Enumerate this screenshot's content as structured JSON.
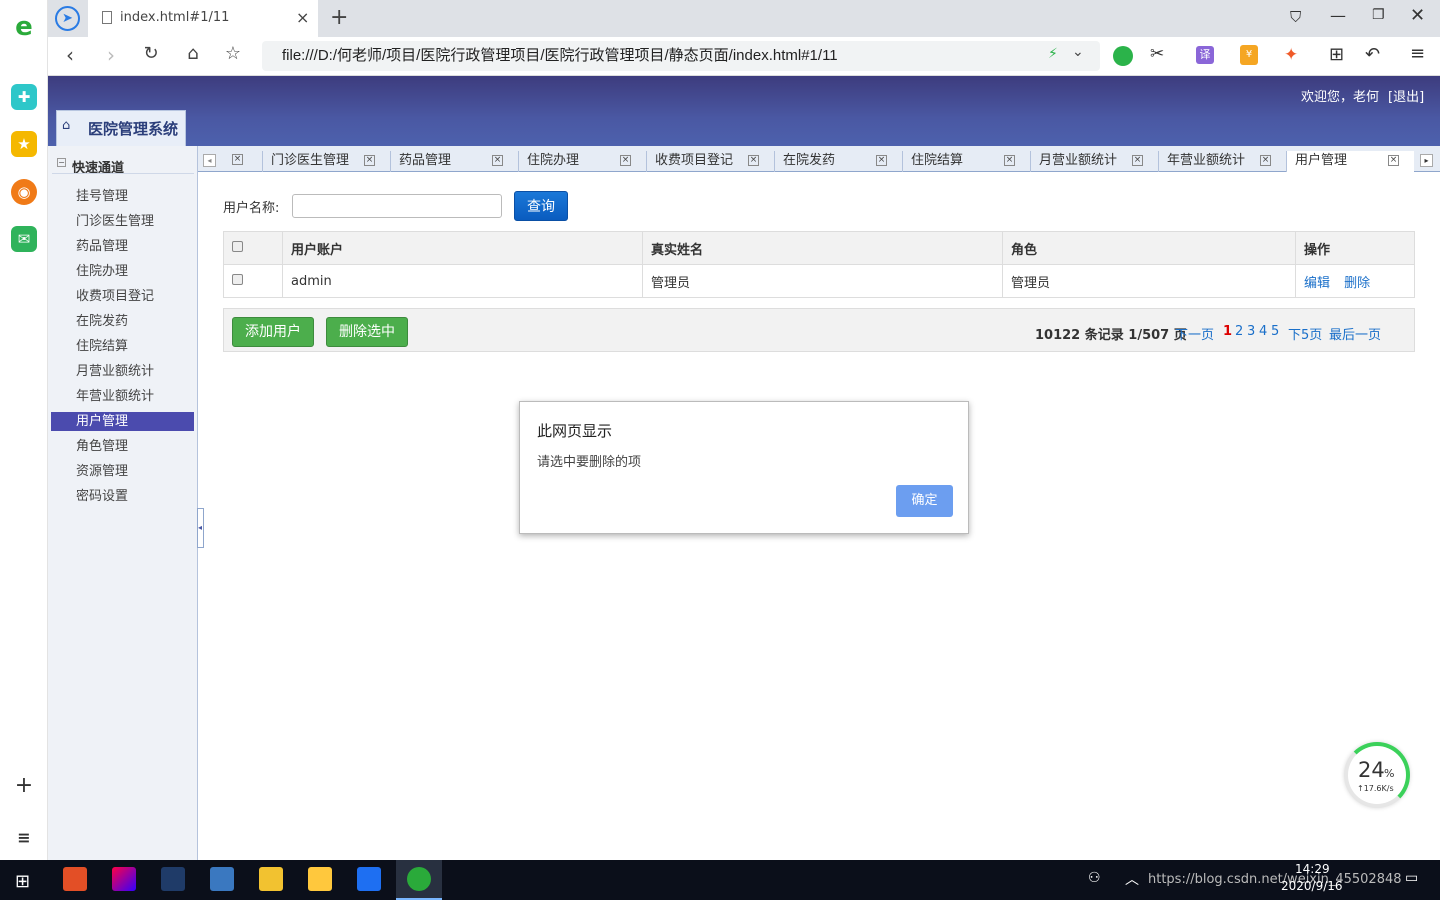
{
  "browser": {
    "tab_title": "index.html#1/11",
    "address": "file:///D:/何老师/项目/医院行政管理项目/医院行政管理项目/静态页面/index.html#1/11"
  },
  "app": {
    "welcome": "欢迎您，老何",
    "logout": "[退出]",
    "title": "医院管理系统"
  },
  "nav": {
    "section_title": "快速通道",
    "items": [
      "挂号管理",
      "门诊医生管理",
      "药品管理",
      "住院办理",
      "收费项目登记",
      "在院发药",
      "住院结算",
      "月营业额统计",
      "年营业额统计",
      "用户管理",
      "角色管理",
      "资源管理",
      "密码设置"
    ],
    "active": "用户管理"
  },
  "tabs": [
    "门诊医生管理",
    "药品管理",
    "住院办理",
    "收费项目登记",
    "在院发药",
    "住院结算",
    "月营业额统计",
    "年营业额统计",
    "用户管理"
  ],
  "search": {
    "label": "用户名称:",
    "value": "",
    "button": "查询"
  },
  "table": {
    "headers": [
      "用户账户",
      "真实姓名",
      "角色",
      "操作"
    ],
    "rows": [
      {
        "account": "admin",
        "name": "管理员",
        "role": "管理员",
        "edit": "编辑",
        "delete": "删除"
      }
    ]
  },
  "actions": {
    "add": "添加用户",
    "delete_selected": "删除选中"
  },
  "pagination": {
    "summary": "10122 条记录 1/507 页",
    "next": "下一页",
    "pages": [
      "1",
      "2",
      "3",
      "4",
      "5"
    ],
    "next5": "下5页",
    "last": "最后一页"
  },
  "dialog": {
    "title": "此网页显示",
    "message": "请选中要删除的项",
    "ok": "确定"
  },
  "widget": {
    "percent": "24",
    "unit": "%",
    "speed": "↑17.6K/s"
  },
  "taskbar": {
    "time": "14:29",
    "date": "2020/9/16",
    "watermark": "https://blog.csdn.net/weixin_45502848"
  },
  "colors": {
    "header": "#4a58a3",
    "active_nav": "#4b4bae",
    "primary_button": "#0a65c8",
    "green_button": "#4cae4c",
    "dialog_button": "#6c9ef0"
  }
}
